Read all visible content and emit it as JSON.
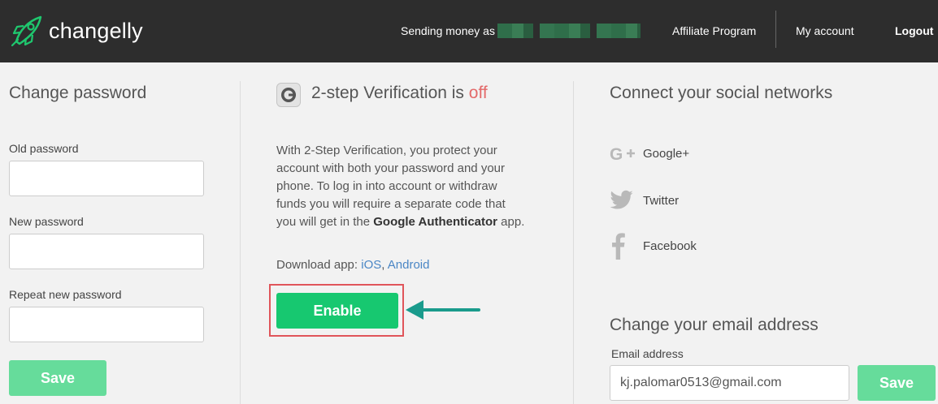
{
  "header": {
    "logo_text": "changelly",
    "sending_label": "Sending money as",
    "nav": {
      "affiliate": "Affiliate Program",
      "account": "My account",
      "logout": "Logout"
    }
  },
  "change_password": {
    "title": "Change password",
    "old_label": "Old password",
    "new_label": "New password",
    "repeat_label": "Repeat new password",
    "save_label": "Save"
  },
  "two_step": {
    "title_prefix": "2-step Verification is ",
    "status": "off",
    "desc_part1": "With 2-Step Verification, you protect your account with both your password and your phone. To log in into account or withdraw funds you will require a separate code that you will get in the ",
    "desc_app": "Google Authenticator",
    "desc_part2": " app.",
    "download_label": "Download app: ",
    "ios": "iOS",
    "sep": ", ",
    "android": "Android",
    "enable_label": "Enable"
  },
  "social": {
    "title": "Connect your social networks",
    "google": "Google+",
    "twitter": "Twitter",
    "facebook": "Facebook"
  },
  "email": {
    "title": "Change your email address",
    "label": "Email address",
    "value": "kj.palomar0513@gmail.com",
    "save_label": "Save"
  },
  "colors": {
    "topbar": "#2d2d2d",
    "enable": "#17c870",
    "save_disabled": "#66dc9b",
    "status_off": "#e36a6a",
    "link": "#4a86c5",
    "highlight": "#e0555a",
    "arrow": "#1a9b8c"
  }
}
